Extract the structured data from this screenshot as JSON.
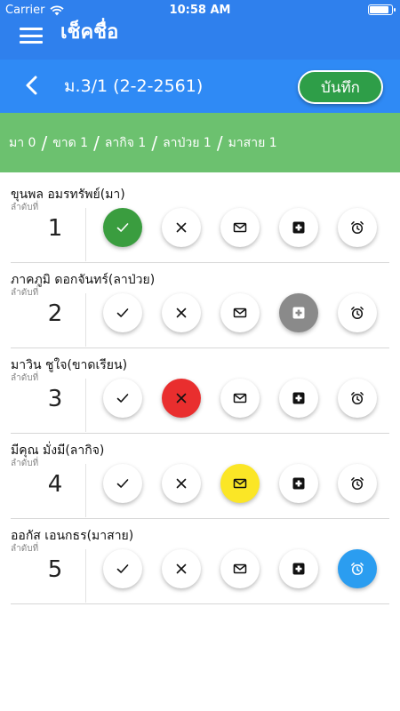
{
  "status": {
    "carrier": "Carrier",
    "time": "10:58 AM"
  },
  "appbar": {
    "title": "เช็คชื่อ"
  },
  "classbar": {
    "classname": "ม.3/1 (2-2-2561)",
    "save_label": "บันทึก"
  },
  "summary": {
    "present": "มา 0",
    "absent": "ขาด 1",
    "leave": "ลากิจ 1",
    "sick": "ลาป่วย 1",
    "late": "มาสาย 1"
  },
  "order_label": "ลำดับที่",
  "colors": {
    "present": "#3a9d3f",
    "absent": "#e92e2e",
    "leave": "#fbe626",
    "sick": "#8a8a8a",
    "late": "#2b9df0",
    "appbar": "#2f80ed",
    "summary": "#6cc16f"
  },
  "status_icons": [
    "check-icon",
    "close-icon",
    "mail-icon",
    "medical-cross-icon",
    "alarm-clock-icon"
  ],
  "students": [
    {
      "number": "1",
      "name": "ขุนพล อมรทรัพย์",
      "status": "(มา)",
      "selected": "present"
    },
    {
      "number": "2",
      "name": "ภาคภูมิ ดอกจันทร์",
      "status": "(ลาป่วย)",
      "selected": "sick"
    },
    {
      "number": "3",
      "name": "มาวิน ชูใจ",
      "status": "(ขาดเรียน)",
      "selected": "absent"
    },
    {
      "number": "4",
      "name": "มีคุณ มั่งมี",
      "status": "(ลากิจ)",
      "selected": "leave"
    },
    {
      "number": "5",
      "name": "ออกัส เอนกธร",
      "status": "(มาสาย)",
      "selected": "late"
    }
  ]
}
